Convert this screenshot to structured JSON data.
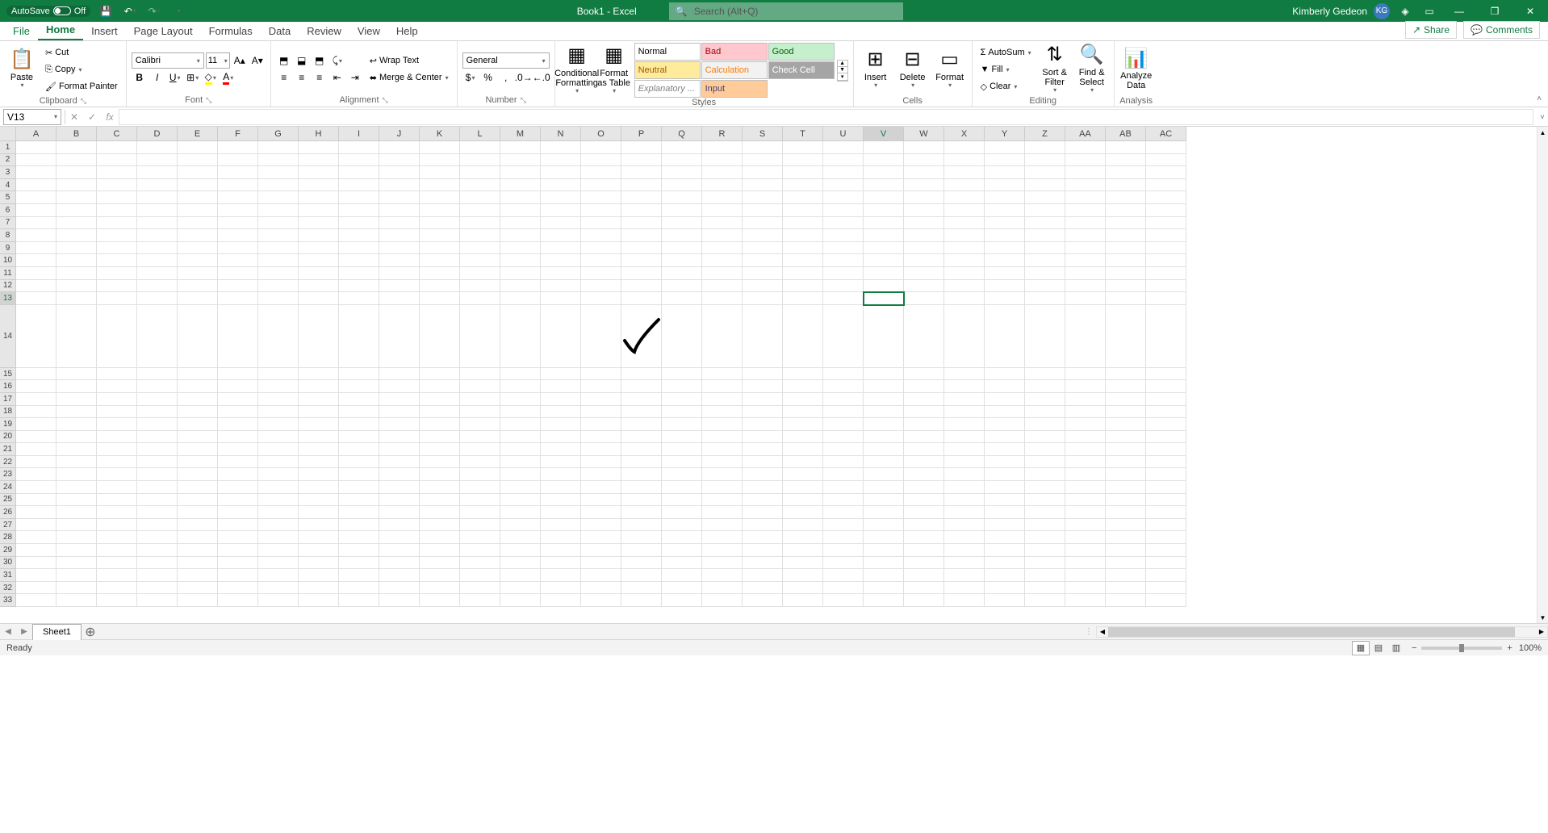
{
  "title": {
    "autosave_label": "AutoSave",
    "autosave_state": "Off",
    "doc_name": "Book1",
    "app_suffix": " - Excel",
    "search_placeholder": "Search (Alt+Q)",
    "user_name": "Kimberly Gedeon",
    "user_initials": "KG"
  },
  "tabs": {
    "file": "File",
    "list": [
      "Home",
      "Insert",
      "Page Layout",
      "Formulas",
      "Data",
      "Review",
      "View",
      "Help"
    ],
    "active_index": 0,
    "share": "Share",
    "comments": "Comments"
  },
  "ribbon": {
    "clipboard": {
      "label": "Clipboard",
      "paste": "Paste",
      "cut": "Cut",
      "copy": "Copy",
      "format_painter": "Format Painter"
    },
    "font": {
      "label": "Font",
      "name": "Calibri",
      "size": "11"
    },
    "alignment": {
      "label": "Alignment",
      "wrap": "Wrap Text",
      "merge": "Merge & Center"
    },
    "number": {
      "label": "Number",
      "format": "General"
    },
    "styles": {
      "label": "Styles",
      "cond_fmt": "Conditional Formatting",
      "fmt_table": "Format as Table",
      "gallery": [
        "Normal",
        "Bad",
        "Good",
        "Neutral",
        "Calculation",
        "Check Cell",
        "Explanatory ...",
        "Input"
      ]
    },
    "cells": {
      "label": "Cells",
      "insert": "Insert",
      "delete": "Delete",
      "format": "Format"
    },
    "editing": {
      "label": "Editing",
      "autosum": "AutoSum",
      "fill": "Fill",
      "clear": "Clear",
      "sort": "Sort & Filter",
      "find": "Find & Select"
    },
    "analysis": {
      "label": "Analysis",
      "analyze": "Analyze Data"
    }
  },
  "formula_bar": {
    "name_box": "V13",
    "formula": ""
  },
  "grid": {
    "columns": [
      "A",
      "B",
      "C",
      "D",
      "E",
      "F",
      "G",
      "H",
      "I",
      "J",
      "K",
      "L",
      "M",
      "N",
      "O",
      "P",
      "Q",
      "R",
      "S",
      "T",
      "U",
      "V",
      "W",
      "X",
      "Y",
      "Z",
      "AA",
      "AB",
      "AC"
    ],
    "row_count": 33,
    "tall_row": 14,
    "selected_col_index": 21,
    "selected_row": 13,
    "checkmark_col_index": 15
  },
  "sheets": {
    "active": "Sheet1"
  },
  "status": {
    "ready": "Ready",
    "zoom": "100%"
  }
}
